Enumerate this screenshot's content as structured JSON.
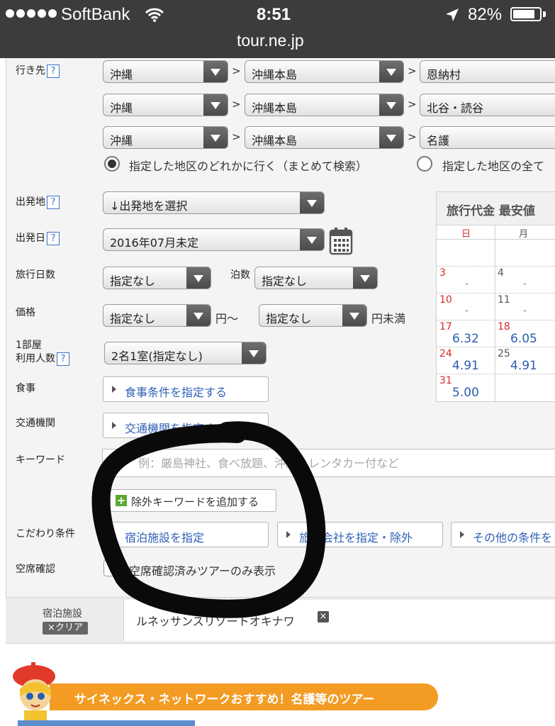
{
  "status_bar": {
    "carrier": "SoftBank",
    "time": "8:51",
    "battery": "82%",
    "url": "tour.ne.jp",
    "signal_bars": 5
  },
  "form": {
    "destination": {
      "label": "行き先",
      "help": "?",
      "rows": [
        [
          "沖縄",
          "沖縄本島",
          "恩納村"
        ],
        [
          "沖縄",
          "沖縄本島",
          "北谷・読谷"
        ],
        [
          "沖縄",
          "沖縄本島",
          "名護"
        ]
      ],
      "separator": ">",
      "radio_any": "指定した地区のどれかに行く（まとめて検索）",
      "radio_all": "指定した地区の全て"
    },
    "departure": {
      "label": "出発地",
      "help": "?",
      "value": "↓出発地を選択"
    },
    "departure_date": {
      "label": "出発日",
      "help": "?",
      "value": "2016年07月未定"
    },
    "trip_days": {
      "label": "旅行日数",
      "value": "指定なし",
      "nights_label": "泊数",
      "nights_value": "指定なし"
    },
    "price": {
      "label": "価格",
      "min": "指定なし",
      "unit_from": "円〜",
      "max": "指定なし",
      "unit_to": "円未満"
    },
    "people": {
      "label1": "1部屋",
      "label2": "利用人数",
      "help": "?",
      "value": "2名1室(指定なし)"
    },
    "meal": {
      "label": "食事",
      "button": "食事条件を指定する"
    },
    "transport": {
      "label": "交通機関",
      "button": "交通機関を指定する"
    },
    "keyword": {
      "label": "キーワード",
      "placeholder": "例：厳島神社、食べ放題、沖縄、レンタカー付など",
      "exclude_button": "除外キーワードを追加する"
    },
    "conditions": {
      "label": "こだわり条件",
      "hotel": "宿泊施設を指定",
      "agency": "旅行会社を指定・除外",
      "other": "その他の条件を"
    },
    "availability": {
      "label": "空席確認",
      "checkbox_label": "空席確認済みツアーのみ表示"
    }
  },
  "calendar": {
    "title": "旅行代金 最安値",
    "weekday_sun": "日",
    "weekday_mon": "月",
    "rows": [
      {
        "sun": "",
        "sun_price": "",
        "mon": "",
        "mon_price": ""
      },
      {
        "sun": "3",
        "sun_price": "-",
        "mon": "4",
        "mon_price": "-"
      },
      {
        "sun": "10",
        "sun_price": "-",
        "mon": "11",
        "mon_price": "-"
      },
      {
        "sun": "17",
        "sun_price": "6.32",
        "mon": "18",
        "mon_price": "6.05"
      },
      {
        "sun": "24",
        "sun_price": "4.91",
        "mon": "25",
        "mon_price": "4.91"
      },
      {
        "sun": "31",
        "sun_price": "5.00",
        "mon": "",
        "mon_price": ""
      }
    ],
    "colors": {
      "sunday": "#d42a2a",
      "holiday_mon": "#d42a2a",
      "price": "#2a5db0"
    }
  },
  "hotel_bar": {
    "label": "宿泊施設",
    "clear": "×クリア",
    "value": "ルネッサンスリゾートオキナワ"
  },
  "promo": {
    "text": "サイネックス・ネットワークおすすめ！名護等のツアー",
    "color": "#f39b23"
  }
}
